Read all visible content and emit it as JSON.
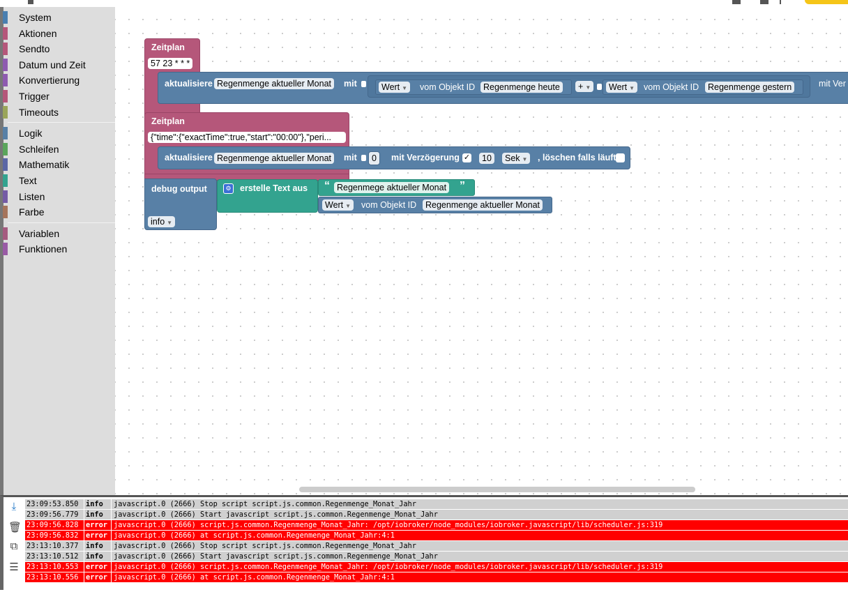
{
  "toolbox": {
    "groups": [
      [
        {
          "label": "System",
          "color": "#4a7fb0"
        },
        {
          "label": "Aktionen",
          "color": "#b5577a"
        },
        {
          "label": "Sendto",
          "color": "#b5577a"
        },
        {
          "label": "Datum und Zeit",
          "color": "#8e5bb0"
        },
        {
          "label": "Konvertierung",
          "color": "#8e5bb0"
        },
        {
          "label": "Trigger",
          "color": "#b5577a"
        },
        {
          "label": "Timeouts",
          "color": "#9aa55a"
        }
      ],
      [
        {
          "label": "Logik",
          "color": "#5880a6"
        },
        {
          "label": "Schleifen",
          "color": "#5ba55b"
        },
        {
          "label": "Mathematik",
          "color": "#5b67a5"
        },
        {
          "label": "Text",
          "color": "#33a38f"
        },
        {
          "label": "Listen",
          "color": "#745ba5"
        },
        {
          "label": "Farbe",
          "color": "#a5745b"
        }
      ],
      [
        {
          "label": "Variablen",
          "color": "#a55b80"
        },
        {
          "label": "Funktionen",
          "color": "#995ba5"
        }
      ]
    ]
  },
  "blocks": {
    "zeitplan1": {
      "title": "Zeitplan",
      "cron": "57 23 * * *"
    },
    "update1": {
      "label": "aktualisiere",
      "target": "Regenmenge aktueller Monat",
      "mit": "mit",
      "wert1": "Wert",
      "vom": "vom Objekt ID",
      "obj1": "Regenmenge heute",
      "op": "+",
      "wert2": "Wert",
      "obj2": "Regenmenge gestern",
      "trail": "mit Ver"
    },
    "zeitplan2": {
      "title": "Zeitplan",
      "cron": "{\"time\":{\"exactTime\":true,\"start\":\"00:00\"},\"peri..."
    },
    "update2": {
      "label": "aktualisiere",
      "target": "Regenmenge aktueller Monat",
      "mit": "mit",
      "value": "0",
      "delay_label": "mit Verzögerung",
      "checked": "✓",
      "delay": "10",
      "unit": "Sek",
      "clear_label": ", löschen falls läuft"
    },
    "debug": {
      "label": "debug output",
      "level": "info",
      "create_text": "erstelle Text aus",
      "quote_open": "“",
      "quote_close": "”",
      "text": "Regenmege aktueller Monat",
      "wert": "Wert",
      "vom": "vom Objekt ID",
      "obj": "Regenmenge aktueller Monat"
    }
  },
  "log": [
    {
      "time": "23:09:53.850",
      "level": "info",
      "msg": "javascript.0 (2666) Stop script script.js.common.Regenmenge_Monat_Jahr"
    },
    {
      "time": "23:09:56.779",
      "level": "info",
      "msg": "javascript.0 (2666) Start javascript script.js.common.Regenmenge_Monat_Jahr"
    },
    {
      "time": "23:09:56.828",
      "level": "error",
      "msg": "javascript.0 (2666) script.js.common.Regenmenge_Monat_Jahr: /opt/iobroker/node_modules/iobroker.javascript/lib/scheduler.js:319"
    },
    {
      "time": "23:09:56.832",
      "level": "error",
      "msg": "javascript.0 (2666) at script.js.common.Regenmenge_Monat_Jahr:4:1"
    },
    {
      "time": "23:13:10.377",
      "level": "info",
      "msg": "javascript.0 (2666) Stop script script.js.common.Regenmenge_Monat_Jahr"
    },
    {
      "time": "23:13:10.512",
      "level": "info",
      "msg": "javascript.0 (2666) Start javascript script.js.common.Regenmenge_Monat_Jahr"
    },
    {
      "time": "23:13:10.553",
      "level": "error",
      "msg": "javascript.0 (2666) script.js.common.Regenmenge_Monat_Jahr: /opt/iobroker/node_modules/iobroker.javascript/lib/scheduler.js:319"
    },
    {
      "time": "23:13:10.556",
      "level": "error",
      "msg": "javascript.0 (2666) at script.js.common.Regenmenge_Monat_Jahr:4:1"
    }
  ],
  "log_tools": [
    "scroll-down-icon",
    "trash-icon",
    "copy-icon",
    "list-toggle-icon"
  ]
}
